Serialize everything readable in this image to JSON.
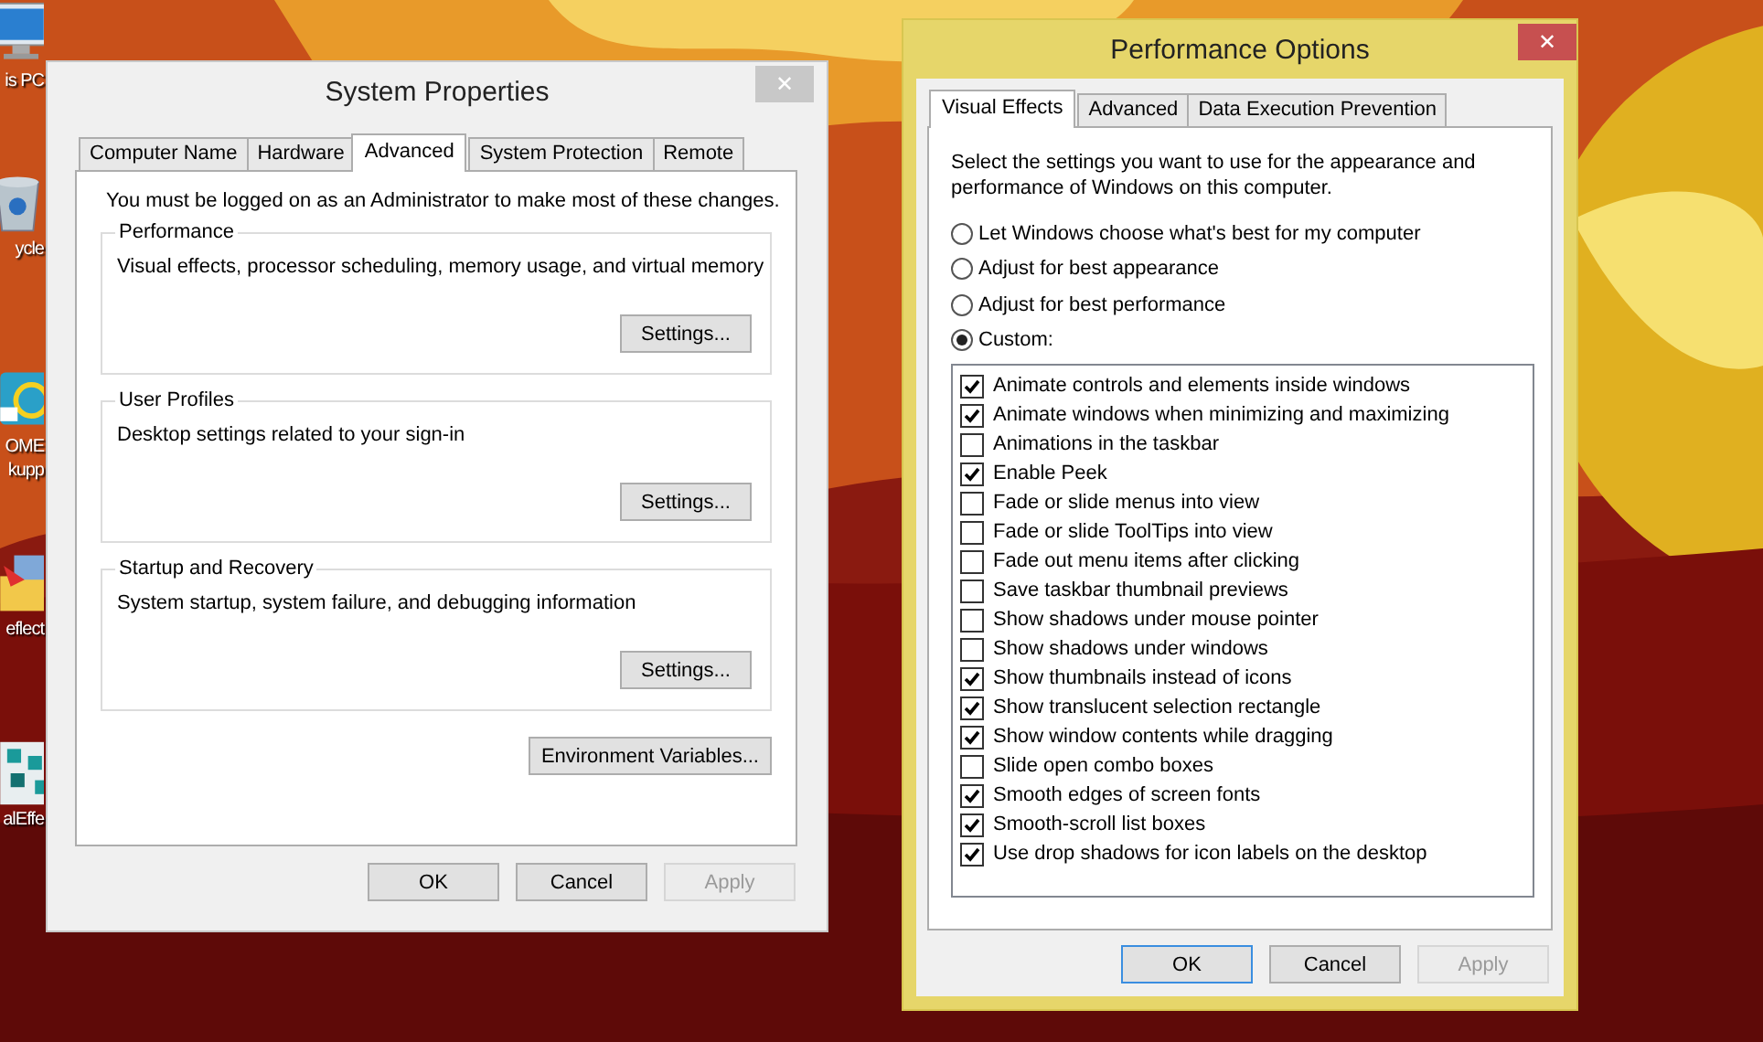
{
  "desktop": {
    "icons": [
      {
        "lines": [
          "is PC"
        ]
      },
      {
        "lines": [
          "ycle"
        ]
      },
      {
        "lines": [
          "OME",
          "kupp"
        ]
      },
      {
        "lines": [
          "eflect"
        ]
      },
      {
        "lines": [
          "alEffe"
        ]
      }
    ]
  },
  "system_properties": {
    "title": "System Properties",
    "close": "✕",
    "tabs": [
      {
        "label": "Computer Name",
        "selected": false
      },
      {
        "label": "Hardware",
        "selected": false
      },
      {
        "label": "Advanced",
        "selected": true
      },
      {
        "label": "System Protection",
        "selected": false
      },
      {
        "label": "Remote",
        "selected": false
      }
    ],
    "notice": "You must be logged on as an Administrator to make most of these changes.",
    "groups": [
      {
        "title": "Performance",
        "description": "Visual effects, processor scheduling, memory usage, and virtual memory",
        "button": "Settings..."
      },
      {
        "title": "User Profiles",
        "description": "Desktop settings related to your sign-in",
        "button": "Settings..."
      },
      {
        "title": "Startup and Recovery",
        "description": "System startup, system failure, and debugging information",
        "button": "Settings..."
      }
    ],
    "extra_button": "Environment Variables...",
    "buttons": [
      {
        "label": "OK",
        "disabled": false
      },
      {
        "label": "Cancel",
        "disabled": false
      },
      {
        "label": "Apply",
        "disabled": true
      }
    ]
  },
  "performance_options": {
    "title": "Performance Options",
    "close": "✕",
    "tabs": [
      {
        "label": "Visual Effects",
        "selected": true
      },
      {
        "label": "Advanced",
        "selected": false
      },
      {
        "label": "Data Execution Prevention",
        "selected": false
      }
    ],
    "intro": "Select the settings you want to use for the appearance and performance of Windows on this computer.",
    "radios": [
      {
        "label": "Let Windows choose what's best for my computer",
        "selected": false
      },
      {
        "label": "Adjust for best appearance",
        "selected": false
      },
      {
        "label": "Adjust for best performance",
        "selected": false
      },
      {
        "label": "Custom:",
        "selected": true
      }
    ],
    "effects": [
      {
        "label": "Animate controls and elements inside windows",
        "checked": true
      },
      {
        "label": "Animate windows when minimizing and maximizing",
        "checked": true
      },
      {
        "label": "Animations in the taskbar",
        "checked": false
      },
      {
        "label": "Enable Peek",
        "checked": true
      },
      {
        "label": "Fade or slide menus into view",
        "checked": false
      },
      {
        "label": "Fade or slide ToolTips into view",
        "checked": false
      },
      {
        "label": "Fade out menu items after clicking",
        "checked": false
      },
      {
        "label": "Save taskbar thumbnail previews",
        "checked": false
      },
      {
        "label": "Show shadows under mouse pointer",
        "checked": false
      },
      {
        "label": "Show shadows under windows",
        "checked": false
      },
      {
        "label": "Show thumbnails instead of icons",
        "checked": true
      },
      {
        "label": "Show translucent selection rectangle",
        "checked": true
      },
      {
        "label": "Show window contents while dragging",
        "checked": true
      },
      {
        "label": "Slide open combo boxes",
        "checked": false
      },
      {
        "label": "Smooth edges of screen fonts",
        "checked": true
      },
      {
        "label": "Smooth-scroll list boxes",
        "checked": true
      },
      {
        "label": "Use drop shadows for icon labels on the desktop",
        "checked": true
      }
    ],
    "buttons": [
      {
        "label": "OK",
        "disabled": false,
        "focused": true
      },
      {
        "label": "Cancel",
        "disabled": false,
        "focused": false
      },
      {
        "label": "Apply",
        "disabled": true,
        "focused": false
      }
    ]
  }
}
